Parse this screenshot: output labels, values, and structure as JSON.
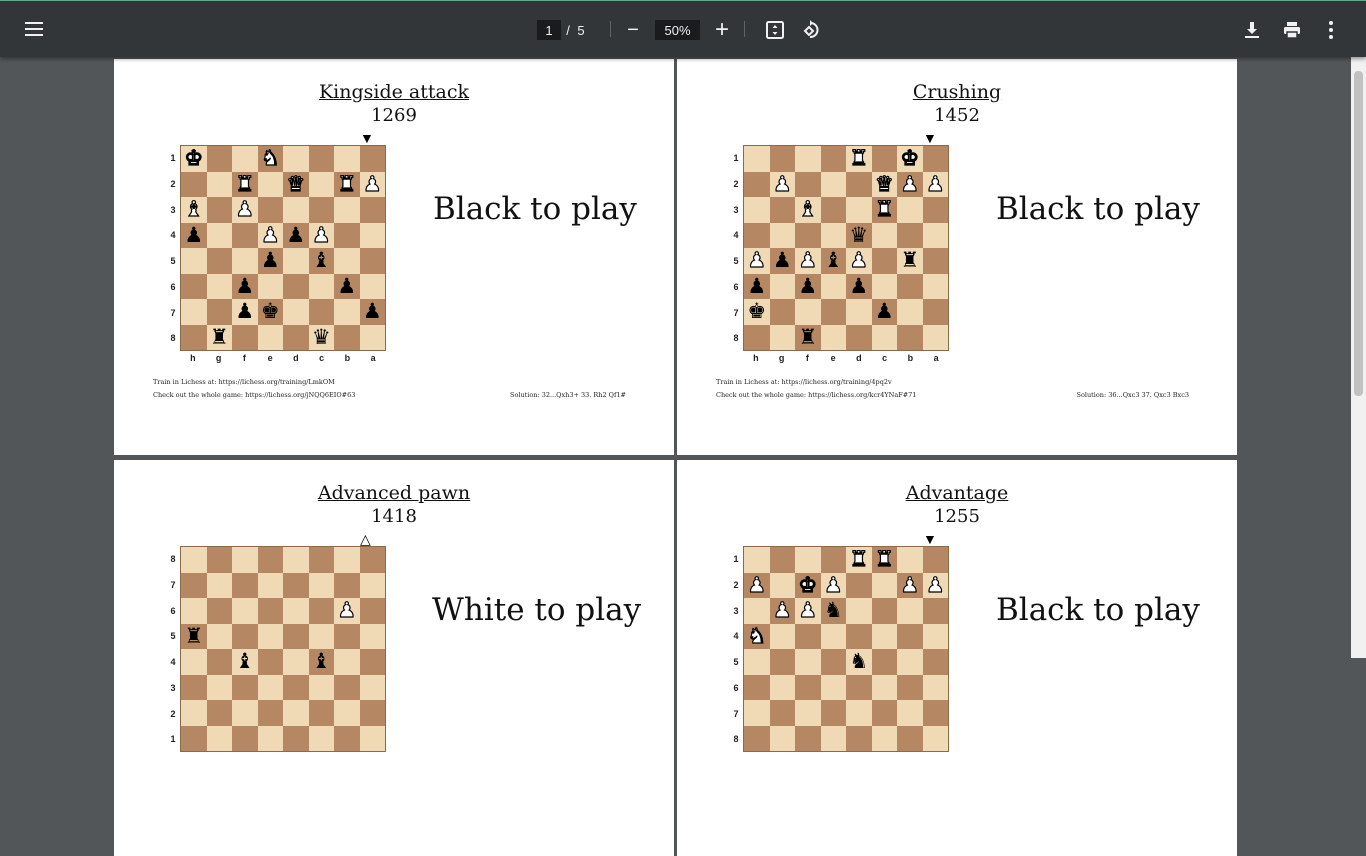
{
  "toolbar": {
    "current_page": "1",
    "page_sep": "/",
    "total_pages": "5",
    "zoom": "50%",
    "icons": [
      "menu-icon",
      "zoom-out-icon",
      "zoom-in-icon",
      "fit-page-icon",
      "rotate-icon",
      "download-icon",
      "print-icon",
      "more-icon"
    ]
  },
  "puzzles": [
    {
      "title": "Kingside attack",
      "rating": "1269",
      "to_move": "Black to play",
      "side": "black",
      "ranks": [
        "1",
        "2",
        "3",
        "4",
        "5",
        "6",
        "7",
        "8"
      ],
      "files": [
        "h",
        "g",
        "f",
        "e",
        "d",
        "c",
        "b",
        "a"
      ],
      "rows": [
        "K..N....",
        "..R.Q.RP",
        "B.P.....",
        "p..PpP..",
        "...p.b..",
        "..p...p.",
        "..pk...p",
        ".r...q.."
      ],
      "train": "Train in Lichess at: https://lichess.org/training/LmkOM",
      "game": "Check out the whole game: https://lichess.org/jNQQ6EIO#63",
      "solution": "Solution: 32...Qxh3+ 33. Rh2 Qf1#"
    },
    {
      "title": "Crushing",
      "rating": "1452",
      "to_move": "Black to play",
      "side": "black",
      "ranks": [
        "1",
        "2",
        "3",
        "4",
        "5",
        "6",
        "7",
        "8"
      ],
      "files": [
        "h",
        "g",
        "f",
        "e",
        "d",
        "c",
        "b",
        "a"
      ],
      "rows": [
        "....R.K.",
        ".P...QPP",
        "..B..R..",
        "....q...",
        "PpPbP.r.",
        "p.p.p...",
        "k....p..",
        "..r....."
      ],
      "train": "Train in Lichess at: https://lichess.org/training/4pq2v",
      "game": "Check out the whole game: https://lichess.org/kcr4YNaF#71",
      "solution": "Solution: 36...Qxc3 37. Qxc3 Bxc3"
    },
    {
      "title": "Advanced pawn",
      "rating": "1418",
      "to_move": "White to play",
      "side": "white",
      "ranks": [
        "8",
        "7",
        "6",
        "5",
        "4",
        "3",
        "2",
        "1"
      ],
      "files": [],
      "rows": [
        "........",
        "........",
        "......P.",
        "r.......",
        "..b..b..",
        "........",
        "........",
        "........"
      ]
    },
    {
      "title": "Advantage",
      "rating": "1255",
      "to_move": "Black to play",
      "side": "black",
      "ranks": [
        "1",
        "2",
        "3",
        "4",
        "5",
        "6",
        "7",
        "8"
      ],
      "files": [],
      "rows": [
        "....RR..",
        "P.KP..PP",
        ".PPn....",
        "N.......",
        "....n...",
        "........",
        "........",
        "........"
      ]
    }
  ]
}
